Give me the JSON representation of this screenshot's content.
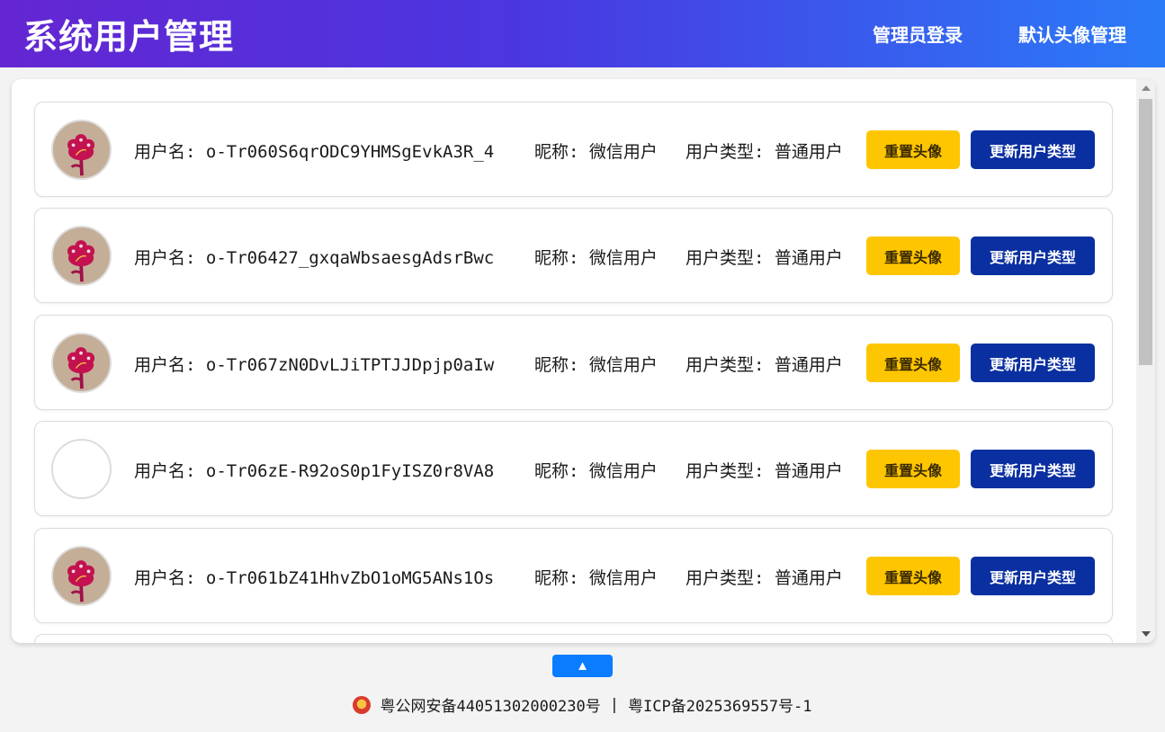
{
  "header": {
    "title": "系统用户管理",
    "nav": [
      {
        "label": "管理员登录"
      },
      {
        "label": "默认头像管理"
      }
    ]
  },
  "users": [
    {
      "username_label": "用户名:",
      "username": "o-Tr060S6qrODC9YHMSgEvkA3R_4",
      "nickname_label": "昵称:",
      "nickname": "微信用户",
      "type_label": "用户类型:",
      "type": "普通用户",
      "avatar": "flower"
    },
    {
      "username_label": "用户名:",
      "username": "o-Tr06427_gxqaWbsaesgAdsrBwc",
      "nickname_label": "昵称:",
      "nickname": "微信用户",
      "type_label": "用户类型:",
      "type": "普通用户",
      "avatar": "flower"
    },
    {
      "username_label": "用户名:",
      "username": "o-Tr067zN0DvLJiTPTJJDpjp0aIw",
      "nickname_label": "昵称:",
      "nickname": "微信用户",
      "type_label": "用户类型:",
      "type": "普通用户",
      "avatar": "flower"
    },
    {
      "username_label": "用户名:",
      "username": "o-Tr06zE-R92oS0p1FyISZ0r8VA8",
      "nickname_label": "昵称:",
      "nickname": "微信用户",
      "type_label": "用户类型:",
      "type": "普通用户",
      "avatar": "empty"
    },
    {
      "username_label": "用户名:",
      "username": "o-Tr061bZ41HhvZbO1oMG5ANs1Os",
      "nickname_label": "昵称:",
      "nickname": "微信用户",
      "type_label": "用户类型:",
      "type": "普通用户",
      "avatar": "flower"
    }
  ],
  "buttons": {
    "reset_avatar": "重置头像",
    "update_type": "更新用户类型"
  },
  "back_to_top": "▲",
  "footer": {
    "police_record": "粤公网安备44051302000230号",
    "separator": "|",
    "icp_record": "粤ICP备2025369557号-1"
  },
  "colors": {
    "header_gradient_start": "#6426d2",
    "header_gradient_end": "#2a7bf8",
    "reset_button": "#fec600",
    "update_button": "#0a2fa0",
    "top_button": "#0a7cff"
  }
}
